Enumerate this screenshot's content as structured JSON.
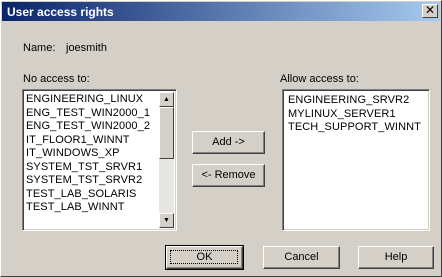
{
  "window": {
    "title": "User access rights",
    "close_glyph": "✕"
  },
  "name_field": {
    "label": "Name:",
    "value": "joesmith"
  },
  "no_access": {
    "label": "No access to:",
    "items": [
      "ENGINEERING_LINUX",
      "ENG_TEST_WIN2000_1",
      "ENG_TEST_WIN2000_2",
      "IT_FLOOR1_WINNT",
      "IT_WINDOWS_XP",
      "SYSTEM_TST_SRVR1",
      "SYSTEM_TST_SRVR2",
      "TEST_LAB_SOLARIS",
      "TEST_LAB_WINNT"
    ]
  },
  "allow_access": {
    "label": "Allow access to:",
    "items": [
      "ENGINEERING_SRVR2",
      "MYLINUX_SERVER1",
      "TECH_SUPPORT_WINNT"
    ]
  },
  "actions": {
    "add_label": "Add ->",
    "remove_label": "<- Remove"
  },
  "footer": {
    "ok_label": "OK",
    "cancel_label": "Cancel",
    "help_label": "Help"
  },
  "icons": {
    "scroll_up": "scroll-up-arrow-icon",
    "scroll_down": "scroll-down-arrow-icon",
    "close": "close-icon"
  },
  "colors": {
    "titlebar_start": "#0a246a",
    "titlebar_end": "#a6caf0",
    "face": "#d4d0c8"
  }
}
